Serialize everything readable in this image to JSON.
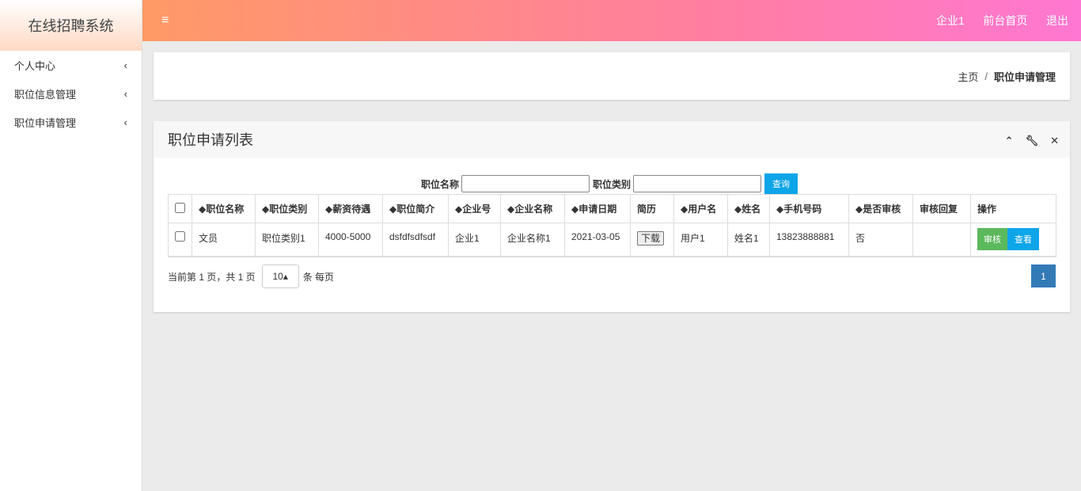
{
  "app": {
    "title": "在线招聘系统"
  },
  "sidebar": {
    "items": [
      {
        "label": "个人中心"
      },
      {
        "label": "职位信息管理"
      },
      {
        "label": "职位申请管理"
      }
    ]
  },
  "topbar": {
    "menu_icon": "≡",
    "links": [
      "企业1",
      "前台首页",
      "退出"
    ]
  },
  "breadcrumb": {
    "home": "主页",
    "sep": "/",
    "current": "职位申请管理"
  },
  "panel": {
    "title": "职位申请列表",
    "tools": [
      "^",
      "🔧",
      "×"
    ]
  },
  "search": {
    "name_label": "职位名称",
    "name_value": "",
    "type_label": "职位类别",
    "type_value": "",
    "query_button": "查询"
  },
  "table": {
    "headers": [
      "◆职位名称",
      "◆职位类别",
      "◆薪资待遇",
      "◆职位简介",
      "◆企业号",
      "◆企业名称",
      "◆申请日期",
      "简历",
      "◆用户名",
      "◆姓名",
      "◆手机号码",
      "◆是否审核",
      "审核回复",
      "操作"
    ],
    "rows": [
      {
        "cells": [
          "文员",
          "职位类别1",
          "4000-5000",
          "dsfdfsdfsdf",
          "企业1",
          "企业名称1",
          "2021-03-05"
        ],
        "resume_button": "下载",
        "cells2": [
          "用户1",
          "姓名1",
          "13823888881",
          "否",
          ""
        ],
        "audit_button": "审核",
        "view_button": "查看"
      }
    ]
  },
  "pager": {
    "info": "当前第 1 页，共 1 页",
    "page_size": "10▴",
    "per_page": "条 每页",
    "current_page": "1"
  }
}
